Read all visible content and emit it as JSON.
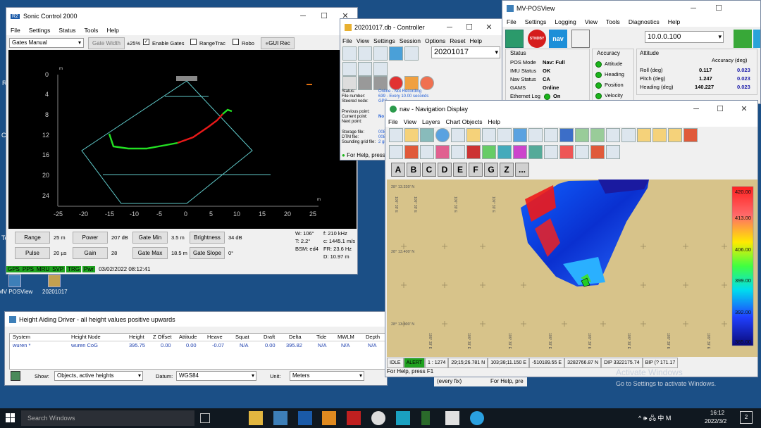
{
  "desktop": {
    "icons": [
      {
        "label": "MV POSView"
      },
      {
        "label": "20201017"
      }
    ],
    "edge_letters": [
      "R",
      "Co",
      "Te"
    ]
  },
  "watermark": {
    "title": "Activate Windows",
    "subtitle": "Go to Settings to activate Windows."
  },
  "sonic": {
    "title": "Sonic Control 2000",
    "title_icon": "R2",
    "menu": [
      "File",
      "Settings",
      "Status",
      "Tools",
      "Help"
    ],
    "mode_select": "Gates Manual",
    "gate_width_label": "Gate Width",
    "gate_pct": "±25%",
    "enable_gates_label": "Enable Gates",
    "enable_gates_checked": true,
    "rangetrac_label": "RangeTrac",
    "robo_label": "Robo",
    "guirec_label": "GUI Rec",
    "yticks": [
      "0",
      "4",
      "8",
      "12",
      "16",
      "20",
      "24"
    ],
    "xticks": [
      "-25",
      "-20",
      "-15",
      "-10",
      "-5",
      "0",
      "5",
      "10",
      "15",
      "20",
      "25"
    ],
    "y_unit": "m",
    "x_unit": "m",
    "params": [
      {
        "label": "Range",
        "value": "25 m"
      },
      {
        "label": "Power",
        "value": "207 dB"
      },
      {
        "label": "Gate Min",
        "value": "3.5 m"
      },
      {
        "label": "Brightness",
        "value": "34 dB"
      },
      {
        "label": "Pulse",
        "value": "20 µs"
      },
      {
        "label": "Gain",
        "value": "28"
      },
      {
        "label": "Gate Max",
        "value": "18.5 m"
      },
      {
        "label": "Gate Slope",
        "value": "0°"
      }
    ],
    "info": {
      "w": "W: 106°",
      "t": "T: 2.2°",
      "bsm": "BSM: ed4",
      "f": "f: 210 kHz",
      "c": "c: 1445.1 m/s",
      "fr": "FR: 23.6 Hz",
      "d": "D: 10.97 m"
    },
    "status": [
      "GPS",
      "PPS",
      "MRU",
      "SVP",
      "TRG",
      "Pwr"
    ],
    "datetime": "03/02/2022 08:12:41"
  },
  "controller": {
    "title": "20201017.db - Controller",
    "menu": [
      "File",
      "View",
      "Settings",
      "Session",
      "Options",
      "Reset",
      "Help"
    ],
    "project": "20201017",
    "fields": [
      {
        "label": "Status:",
        "value": "Online - Not Recording"
      },
      {
        "label": "File number:",
        "value": "639 - Every 10.00 seconds"
      },
      {
        "label": "Steered node:",
        "value": "GPS"
      }
    ],
    "fields2": [
      {
        "label": "Previous point:",
        "value": ""
      },
      {
        "label": "Current point:",
        "value": "No"
      },
      {
        "label": "Next point:",
        "value": ""
      }
    ],
    "fields3": [
      {
        "label": "Storage file:",
        "value": "008"
      },
      {
        "label": "DTM file:",
        "value": "008"
      },
      {
        "label": "Sounding grid file:",
        "value": "2 gr"
      }
    ],
    "statusbar": "For Help, press"
  },
  "posview": {
    "title": "MV-POSView",
    "menu": [
      "File",
      "Settings",
      "Logging",
      "View",
      "Tools",
      "Diagnostics",
      "Help"
    ],
    "ip": "10.0.0.100",
    "stby": "STNDBY",
    "status_title": "Status",
    "status": [
      {
        "label": "POS Mode",
        "value": "Nav: Full"
      },
      {
        "label": "IMU Status",
        "value": "OK"
      },
      {
        "label": "Nav Status",
        "value": "CA"
      },
      {
        "label": "GAMS",
        "value": "Online"
      },
      {
        "label": "Ethernet Log",
        "value": "On"
      }
    ],
    "accuracy_title": "Accuracy",
    "accuracy": [
      "Attitude",
      "Heading",
      "Position",
      "Velocity"
    ],
    "attitude_title": "Attitude",
    "att_acc_header": "Accuracy (deg)",
    "attitude": [
      {
        "label": "Roll (deg)",
        "value": "0.117",
        "acc": "0.023"
      },
      {
        "label": "Pitch (deg)",
        "value": "1.247",
        "acc": "0.023"
      },
      {
        "label": "Heading (deg)",
        "value": "140.227",
        "acc": "0.023"
      }
    ]
  },
  "nav": {
    "title": "nav - Navigation Display",
    "menu": [
      "File",
      "View",
      "Layers",
      "Chart Objects",
      "Help"
    ],
    "letters": [
      "A",
      "B",
      "C",
      "D",
      "E",
      "F",
      "G",
      "Z",
      "..."
    ],
    "ylabels": [
      "28° 13.330' N",
      "28° 13.400' N",
      "28° 13.300' N"
    ],
    "xlabels": [
      "106° 39' E",
      "106° 39' E",
      "106° 39' E",
      "106° 39' E",
      "106° 39' E",
      "106° 39' E",
      "106° 39' E",
      "106° 39' E",
      "106° 39' E",
      "106° 39' E",
      "106° 39' E",
      "106° 39' E"
    ],
    "scale": [
      "420.00",
      "413.00",
      "406.00",
      "399.00",
      "392.00",
      "385.00"
    ],
    "statusbar": [
      "IDLE",
      "ALERT",
      "1 : 1274",
      "29;15;26.781 N",
      "103;38;11.150 E",
      "-510189.55 E",
      "3282766.87 N",
      "DIP 3322175.74",
      "BIP (? 171.17"
    ],
    "help": "For Help, press F1",
    "hidden_help": "For Help, pre",
    "every_fix": "(every fix)"
  },
  "height": {
    "title": "Height Aiding Driver - all height values positive upwards",
    "headers": [
      "System",
      "Height Node",
      "Height",
      "Z Offset",
      "Attitude",
      "Heave",
      "Squat",
      "Draft",
      "Delta",
      "Tide",
      "MWLM",
      "Depth"
    ],
    "row": [
      "wuren *",
      "wuren CoG",
      "395.75",
      "0.00",
      "0.00",
      "-0.07",
      "N/A",
      "0.00",
      "395.82",
      "N/A",
      "N/A",
      "N/A"
    ],
    "show_label": "Show:",
    "show": "Objects, active heights",
    "datum_label": "Datum:",
    "datum": "WGS84",
    "unit_label": "Unit:",
    "unit": "Meters"
  },
  "taskbar": {
    "search": "Search Windows",
    "time": "16:12",
    "date": "2022/3/2",
    "tray": "^ 🕪 🖧 中 M",
    "notif": "2"
  }
}
